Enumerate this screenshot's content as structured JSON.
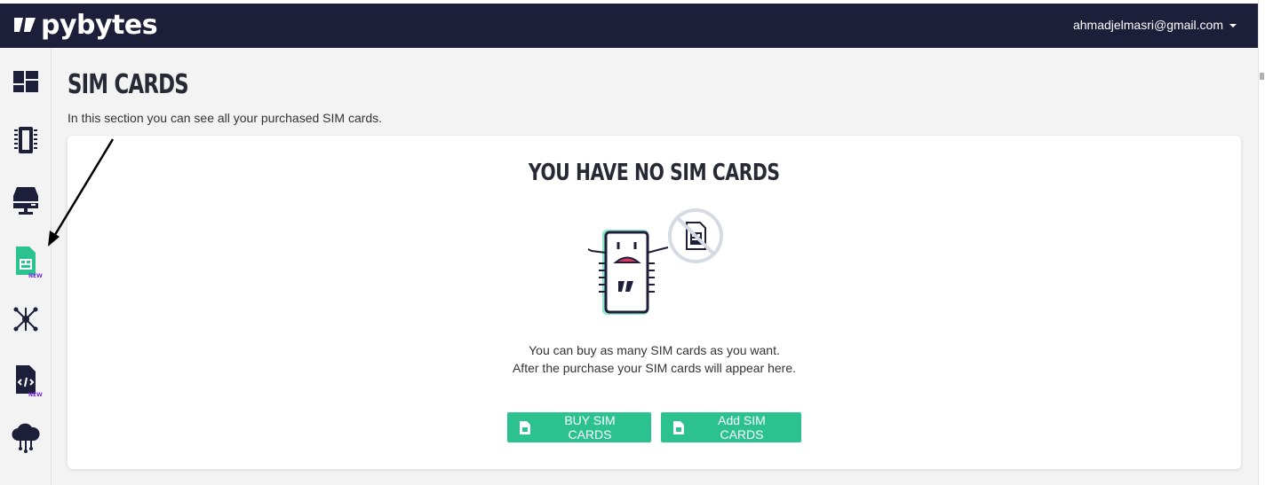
{
  "header": {
    "logo_text": "pybytes",
    "user_email": "ahmadjelmasri@gmail.com"
  },
  "sidebar": {
    "items": [
      {
        "name": "dashboard-icon",
        "badge": ""
      },
      {
        "name": "devices-icon",
        "badge": ""
      },
      {
        "name": "projects-icon",
        "badge": ""
      },
      {
        "name": "sim-card-icon",
        "badge": "NEW",
        "active": true
      },
      {
        "name": "network-icon",
        "badge": ""
      },
      {
        "name": "code-file-icon",
        "badge": "NEW"
      },
      {
        "name": "cloud-icon",
        "badge": ""
      }
    ]
  },
  "page": {
    "title": "SIM CARDS",
    "description": "In this section you can see all your purchased SIM cards."
  },
  "empty_state": {
    "title": "YOU HAVE NO SIM CARDS",
    "line1": "You can buy as many SIM cards as you want.",
    "line2": "After the purchase your SIM cards will appear here."
  },
  "buttons": {
    "buy_label": "BUY SIM CARDS",
    "add_label": "Add SIM CARDS"
  },
  "colors": {
    "topbar": "#1c1e3a",
    "accent_green": "#2bc28f",
    "badge_purple": "#7b2be2",
    "icon_dark": "#1c1e3a"
  }
}
